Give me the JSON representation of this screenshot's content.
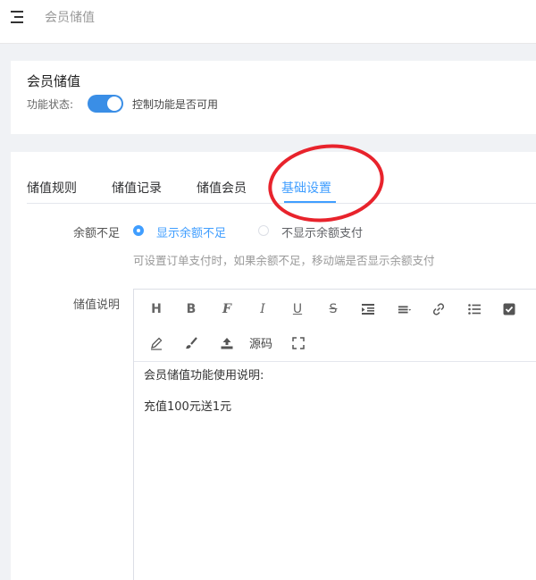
{
  "header": {
    "breadcrumb": "会员储值"
  },
  "card": {
    "title": "会员储值",
    "status_label": "功能状态:",
    "status_on": true,
    "status_desc": "控制功能是否可用"
  },
  "tabs": [
    {
      "label": "储值规则"
    },
    {
      "label": "储值记录"
    },
    {
      "label": "储值会员"
    },
    {
      "label": "基础设置",
      "active": true
    }
  ],
  "balance": {
    "label": "余额不足",
    "options": [
      {
        "label": "显示余额不足",
        "selected": true
      },
      {
        "label": "不显示余额支付",
        "selected": false
      }
    ],
    "hint": "可设置订单支付时，如果余额不足，移动端是否显示余额支付"
  },
  "description": {
    "label": "储值说明",
    "toolbar": {
      "icons": [
        "heading-icon",
        "bold-icon",
        "font-icon",
        "italic-icon",
        "underline-icon",
        "strikethrough-icon",
        "indent-icon",
        "align-icon",
        "link-icon",
        "list-icon",
        "checkbox-icon",
        "pen-icon",
        "brush-icon",
        "upload-icon",
        "fullscreen-icon"
      ],
      "source_label": "源码"
    },
    "content": [
      "会员储值功能使用说明:",
      "充值100元送1元"
    ]
  },
  "colors": {
    "accent": "#409eff",
    "annotation": "#e8232c"
  }
}
